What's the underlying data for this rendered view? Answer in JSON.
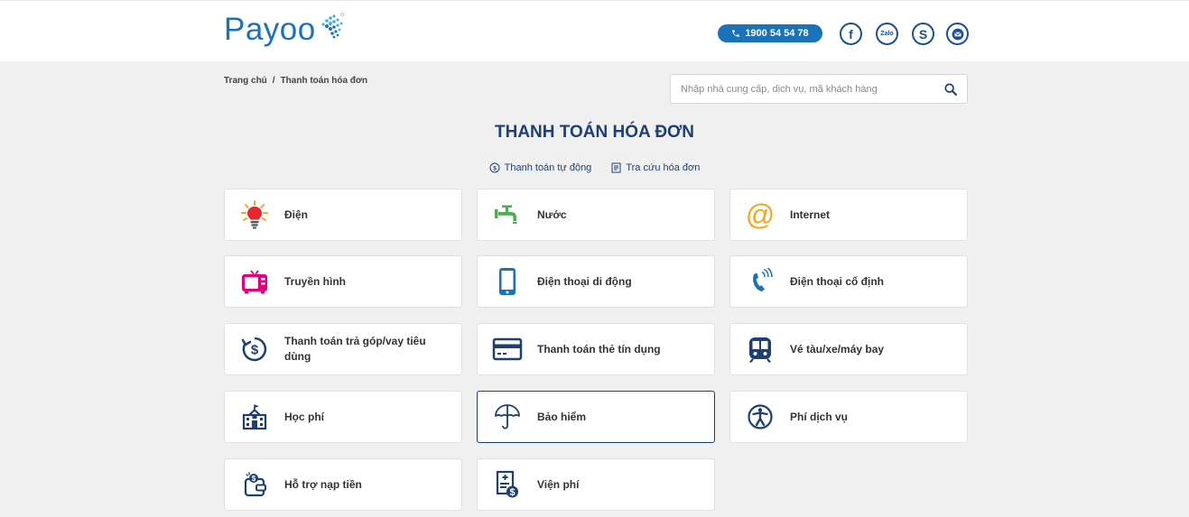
{
  "header": {
    "logo_text": "Payoo",
    "hotline": "1900 54 54 78",
    "social": [
      "facebook-icon",
      "zalo-icon",
      "skype-icon",
      "email-icon"
    ],
    "zalo_label": "Zalo",
    "colors": {
      "brand": "#1a73b8",
      "navy": "#1d3f73"
    }
  },
  "breadcrumb": {
    "home": "Trang chủ",
    "separator": "/",
    "current": "Thanh toán hóa đơn"
  },
  "search": {
    "placeholder": "Nhập nhà cung cấp, dịch vụ, mã khách hàng",
    "value": ""
  },
  "page": {
    "title": "THANH TOÁN HÓA ĐƠN",
    "links": [
      {
        "label": "Thanh toán tự động",
        "icon": "dollar-circle-icon"
      },
      {
        "label": "Tra cứu hóa đơn",
        "icon": "receipt-icon"
      }
    ]
  },
  "categories": [
    {
      "label": "Điện",
      "icon": "lightbulb-icon"
    },
    {
      "label": "Nước",
      "icon": "water-tap-icon"
    },
    {
      "label": "Internet",
      "icon": "at-sign-icon"
    },
    {
      "label": "Truyền hình",
      "icon": "tv-icon"
    },
    {
      "label": "Điện thoại di động",
      "icon": "mobile-phone-icon"
    },
    {
      "label": "Điện thoại cố định",
      "icon": "landline-phone-icon"
    },
    {
      "label": "Thanh toán trả góp/vay tiêu dùng",
      "icon": "installment-icon"
    },
    {
      "label": "Thanh toán thẻ tín dụng",
      "icon": "credit-card-icon"
    },
    {
      "label": "Vé tàu/xe/máy bay",
      "icon": "train-icon"
    },
    {
      "label": "Học phí",
      "icon": "school-icon"
    },
    {
      "label": "Bảo hiểm",
      "icon": "umbrella-icon"
    },
    {
      "label": "Phí dịch vụ",
      "icon": "service-fee-icon"
    },
    {
      "label": "Hỗ trợ nạp tiền",
      "icon": "wallet-topup-icon"
    },
    {
      "label": "Viện phí",
      "icon": "hospital-fee-icon"
    }
  ]
}
